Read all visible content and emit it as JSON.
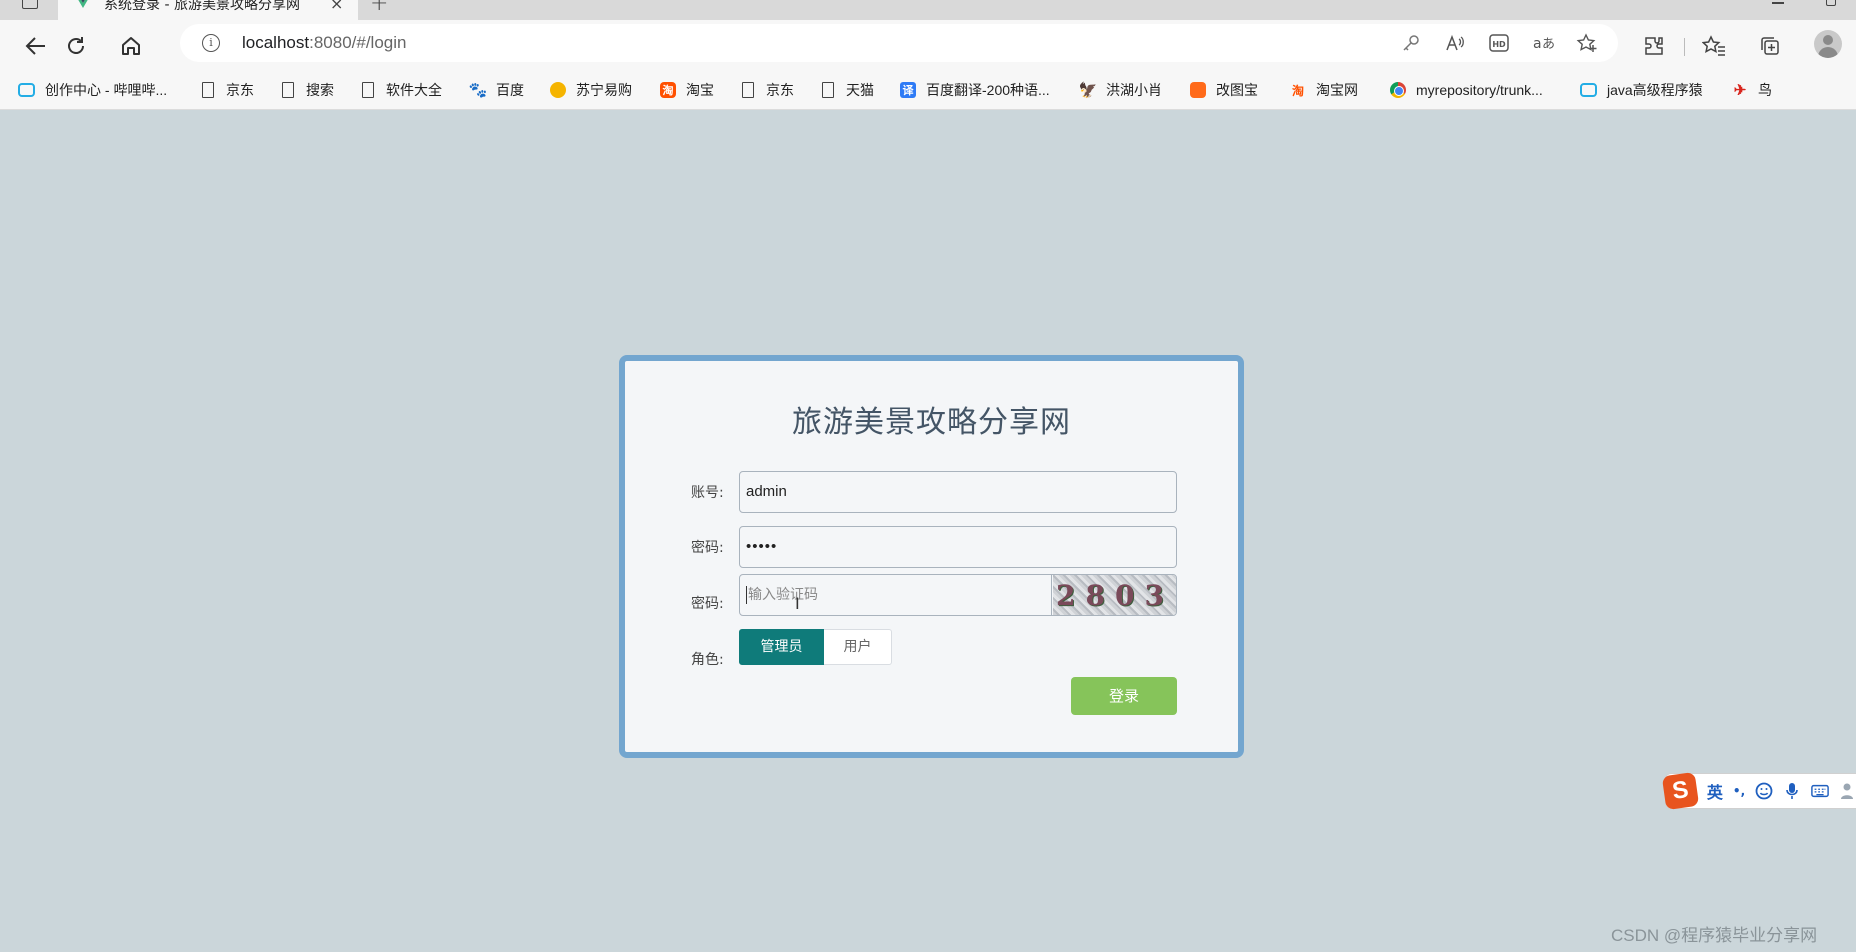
{
  "browser": {
    "tab": {
      "title": "系统登录 - 旅游美景攻略分享网",
      "close": "×"
    },
    "new_tab": "+",
    "address": {
      "host": "localhost",
      "path": ":8080/#/login"
    },
    "bookmarks": [
      {
        "label": "创作中心 - 哔哩哔...",
        "icon": "bilibili-icon"
      },
      {
        "label": "京东",
        "icon": "page-icon"
      },
      {
        "label": "搜索",
        "icon": "page-icon"
      },
      {
        "label": "软件大全",
        "icon": "page-icon"
      },
      {
        "label": "百度",
        "icon": "baidu-paw-icon"
      },
      {
        "label": "苏宁易购",
        "icon": "suning-icon"
      },
      {
        "label": "淘宝",
        "icon": "taobao-icon"
      },
      {
        "label": "京东",
        "icon": "page-icon"
      },
      {
        "label": "天猫",
        "icon": "page-icon"
      },
      {
        "label": "百度翻译-200种语...",
        "icon": "translate-icon"
      },
      {
        "label": "洪湖小肖",
        "icon": "eagle-icon"
      },
      {
        "label": "改图宝",
        "icon": "gaitubao-icon"
      },
      {
        "label": "淘宝网",
        "icon": "taobao-icon"
      },
      {
        "label": "myrepository/trunk...",
        "icon": "chrome-icon"
      },
      {
        "label": "java高级程序猿",
        "icon": "bilibili-icon"
      },
      {
        "label": "鸟",
        "icon": "bird-icon"
      }
    ],
    "taobao_glyph": "淘",
    "translate_glyph": "译",
    "baidu_glyph": "🐾",
    "bird_glyph": "✈"
  },
  "login": {
    "title": "旅游美景攻略分享网",
    "account_label": "账号:",
    "account_value": "admin",
    "password_label": "密码:",
    "password_value": "•••••",
    "captcha_label": "密码:",
    "captcha_placeholder": "输入验证码",
    "captcha_code": "2803",
    "role_label": "角色:",
    "roles": [
      "管理员",
      "用户"
    ],
    "selected_role": "管理员",
    "submit_label": "登录"
  },
  "ime": {
    "logo": "S",
    "mode": "英",
    "punct": "•,",
    "icons": [
      "emoji-icon",
      "microphone-icon",
      "keyboard-icon",
      "user-icon"
    ]
  },
  "watermark": "CSDN @程序猿毕业分享网",
  "colors": {
    "card_border": "#73a6cf",
    "role_active": "#0f7b7a",
    "login_button": "#86c45a",
    "page_bg": "#cbd6da"
  }
}
